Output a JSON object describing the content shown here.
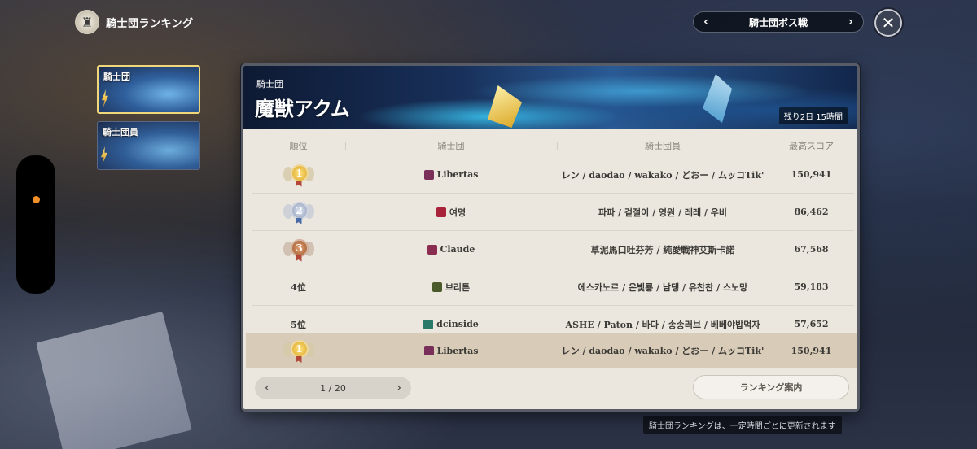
{
  "header": {
    "title": "騎士団ランキング",
    "crest_icon": "shield-crest-icon",
    "mode_selector": {
      "label": "騎士団ボス戦",
      "prev_icon": "chevron-left-icon",
      "next_icon": "chevron-right-icon"
    },
    "close_icon": "close-icon"
  },
  "categories": [
    {
      "label": "騎士団",
      "active": true
    },
    {
      "label": "騎士団員",
      "active": false
    }
  ],
  "banner": {
    "guild_label": "騎士団",
    "boss_name": "魔獣アクム",
    "remaining": "残り2日 15時間"
  },
  "table": {
    "columns": [
      "順位",
      "騎士団",
      "騎士団員",
      "最高スコア"
    ],
    "rows": [
      {
        "rank": "1",
        "medal": "gold",
        "guild": "Libertas",
        "emblem_color": "#7a2e5a",
        "members": "レン / daodao / wakako / どおー / ムッコTik'",
        "score": "150,941"
      },
      {
        "rank": "2",
        "medal": "silver",
        "guild": "여명",
        "emblem_color": "#a8223a",
        "members": "파파 / 겉절이 / 영원 / 레레 / 우비",
        "score": "86,462"
      },
      {
        "rank": "3",
        "medal": "bronze",
        "guild": "Claude",
        "emblem_color": "#8a2d4e",
        "members": "草泥馬口吐芬芳 / 純愛戰神艾斯卡諾",
        "score": "67,568"
      },
      {
        "rank": "4位",
        "medal": "",
        "guild": "브리튼",
        "emblem_color": "#4a5a2a",
        "members": "에스카노르 / 은빛룡 / 남댕 / 유찬찬 / 스노망",
        "score": "59,183"
      },
      {
        "rank": "5位",
        "medal": "",
        "guild": "dcinside",
        "emblem_color": "#2a7a6a",
        "members": "ASHE / Paton / 바다 / 송송러브 / 베베야밥먹자",
        "score": "57,652"
      }
    ],
    "my_guild": {
      "rank": "1",
      "medal": "gold",
      "guild": "Libertas",
      "emblem_color": "#7a2e5a",
      "members": "レン / daodao / wakako / どおー / ムッコTik'",
      "score": "150,941"
    }
  },
  "pagination": {
    "current": "1 / 20",
    "prev_icon": "chevron-left-icon",
    "next_icon": "chevron-right-icon"
  },
  "guide_button": "ランキング案内",
  "footer_note": "騎士団ランキングは、一定時間ごとに更新されます"
}
